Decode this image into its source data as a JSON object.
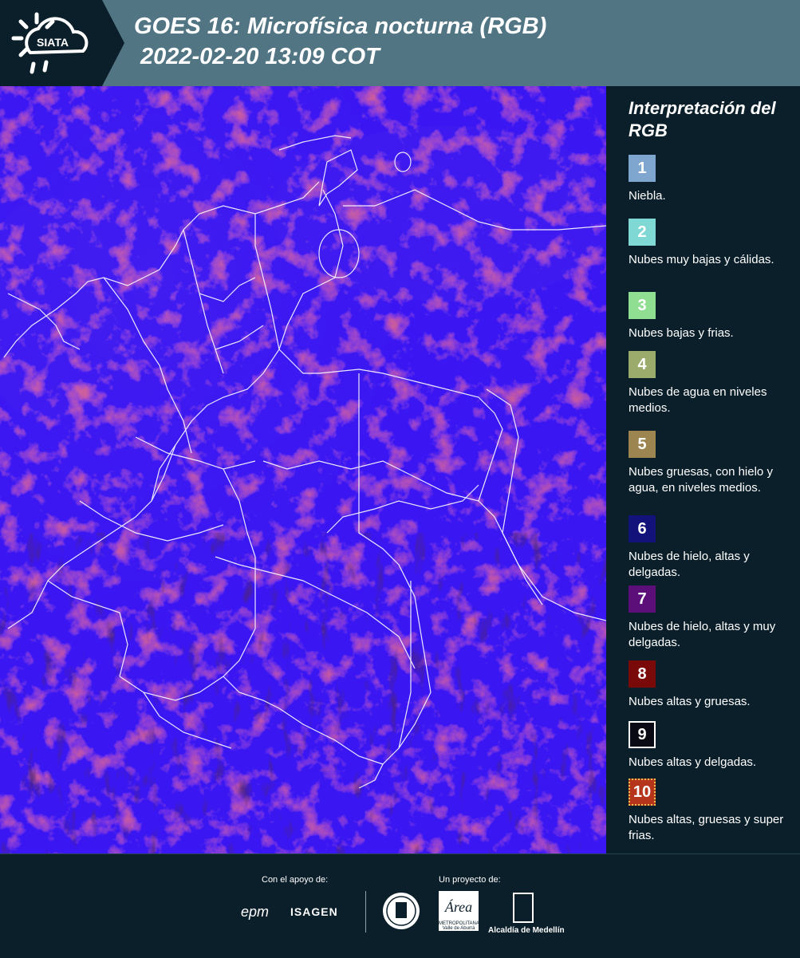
{
  "header": {
    "logo_text": "SIATA",
    "title_line1": "GOES 16: Microfísica nocturna (RGB)",
    "title_line2": "2022-02-20 13:09 COT"
  },
  "colors": {
    "header_bg": "#527584",
    "panel_bg": "#0b1f2a",
    "map_base": "#3a19f2",
    "map_cloud_red": "#b0245a",
    "border_line": "#ffffff"
  },
  "legend": {
    "title": "Interpretación del RGB",
    "items": [
      {
        "number": "1",
        "label": "Niebla.",
        "color": "#7fa6cf",
        "text_color": "#ffffff"
      },
      {
        "number": "2",
        "label": "Nubes muy bajas y cálidas.",
        "color": "#7fd8d3",
        "text_color": "#ffffff"
      },
      {
        "number": "3",
        "label": "Nubes bajas y frias.",
        "color": "#8fde91",
        "text_color": "#ffffff"
      },
      {
        "number": "4",
        "label": "Nubes de agua en niveles medios.",
        "color": "#9aab6b",
        "text_color": "#ffffff"
      },
      {
        "number": "5",
        "label": "Nubes gruesas, con hielo y agua, en niveles medios.",
        "color": "#9c8551",
        "text_color": "#ffffff"
      },
      {
        "number": "6",
        "label": "Nubes de hielo, altas y delgadas.",
        "color": "#12127a",
        "text_color": "#ffffff"
      },
      {
        "number": "7",
        "label": "Nubes de hielo, altas y muy delgadas.",
        "color": "#5c0f78",
        "text_color": "#ffffff"
      },
      {
        "number": "8",
        "label": "Nubes altas y gruesas.",
        "color": "#7a0a0a",
        "text_color": "#ffffff"
      },
      {
        "number": "9",
        "label": "Nubes altas y delgadas.",
        "color": "#0a0a14",
        "text_color": "#ffffff"
      },
      {
        "number": "10",
        "label": "Nubes altas, gruesas y super frias.",
        "color": "#b5341c",
        "text_color": "#ffffff"
      }
    ]
  },
  "footer": {
    "support_label": "Con el apoyo de:",
    "project_label": "Un proyecto de:",
    "epm": "epm",
    "isagen": "ISAGEN",
    "area_logo": "Área",
    "area_sub": "METROPOLITANA Valle de Aburrá",
    "alcaldia": "Alcaldía de Medellín"
  }
}
